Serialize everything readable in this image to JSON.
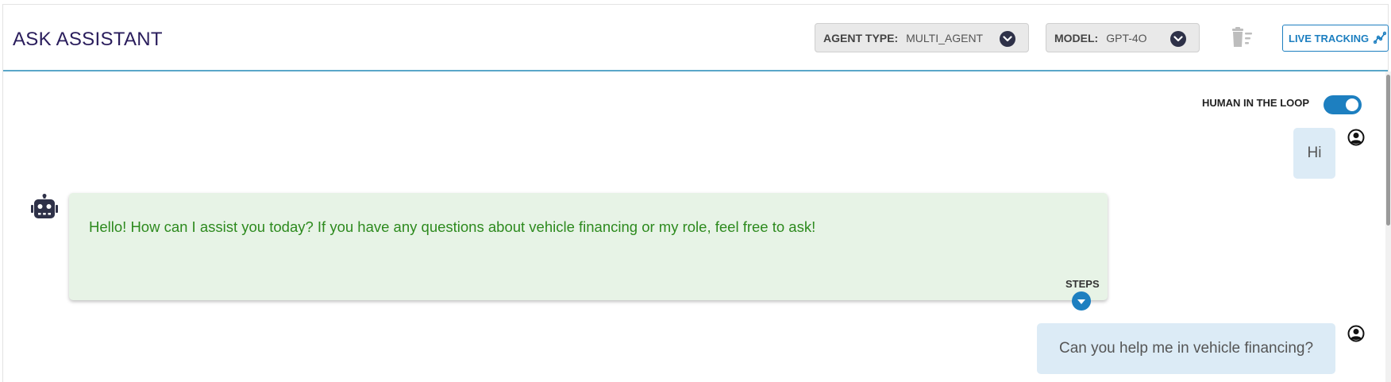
{
  "header": {
    "title": "ASK ASSISTANT",
    "agent_type": {
      "label": "AGENT TYPE:",
      "value": "MULTI_AGENT"
    },
    "model": {
      "label": "MODEL:",
      "value": "GPT-4O"
    },
    "clear_icon": "trash-clear-icon",
    "live_tracking_label": "LIVE TRACKING",
    "live_tracking_icon": "trending-line-icon"
  },
  "settings": {
    "human_in_the_loop_label": "HUMAN IN THE LOOP",
    "human_in_the_loop_enabled": true
  },
  "messages": [
    {
      "role": "user",
      "text": "Hi",
      "avatar_icon": "user-circle-icon"
    },
    {
      "role": "assistant",
      "text": "Hello! How can I assist you today? If you have any questions about vehicle financing or my role, feel free to ask!",
      "avatar_icon": "robot-icon",
      "steps_label": "STEPS"
    },
    {
      "role": "user",
      "text": "Can you help me in vehicle financing?",
      "avatar_icon": "user-circle-icon"
    }
  ],
  "colors": {
    "title": "#2a1d5c",
    "accent": "#1d7fc0",
    "user_bubble": "#dcebf6",
    "assistant_bubble": "#e7f3e6",
    "assistant_text": "#2d8a1e",
    "header_border": "#5aa7c9"
  }
}
